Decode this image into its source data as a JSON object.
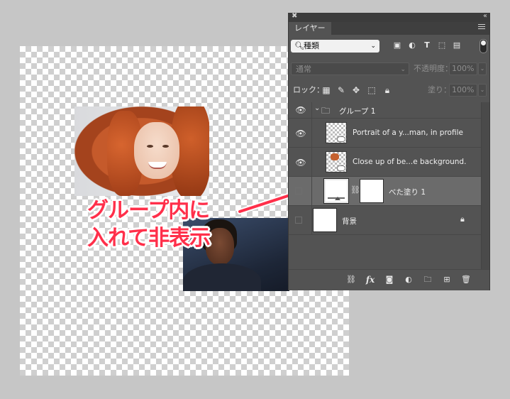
{
  "annotation": {
    "line1": "グループ内に",
    "line2": "入れて非表示"
  },
  "panel": {
    "tab_label": "レイヤー",
    "filter": {
      "kind_label": "種類"
    },
    "blend_mode": "通常",
    "opacity_label": "不透明度：",
    "opacity_value": "100%",
    "lock_label": "ロック：",
    "fill_label": "塗り：",
    "fill_value": "100%"
  },
  "layers": [
    {
      "name": "グループ 1",
      "type": "group",
      "visible": true
    },
    {
      "name": "Portrait of a y...man, in profile",
      "type": "smart-object",
      "visible": true
    },
    {
      "name": "Close up of be...e background.",
      "type": "smart-object",
      "visible": true
    },
    {
      "name": "べた塗り 1",
      "type": "solid-fill",
      "visible": false,
      "selected": true
    },
    {
      "name": "背景",
      "type": "background",
      "visible": false,
      "locked": true
    }
  ],
  "colors": {
    "panel_bg": "#535353",
    "selected_row": "#6b6b6b",
    "annotation": "#ff2f4a",
    "workspace": "#c6c6c6"
  },
  "icons": {
    "filter": [
      "image-filter-icon",
      "adjustment-filter-icon",
      "type-filter-icon",
      "shape-filter-icon",
      "smartobject-filter-icon"
    ],
    "lock": [
      "lock-transparent-icon",
      "lock-image-icon",
      "lock-position-icon",
      "lock-artboard-icon",
      "lock-all-icon"
    ],
    "footer": [
      "link-layers-icon",
      "fx-icon",
      "add-mask-icon",
      "adjustment-layer-icon",
      "new-group-icon",
      "new-layer-icon",
      "delete-layer-icon"
    ]
  }
}
